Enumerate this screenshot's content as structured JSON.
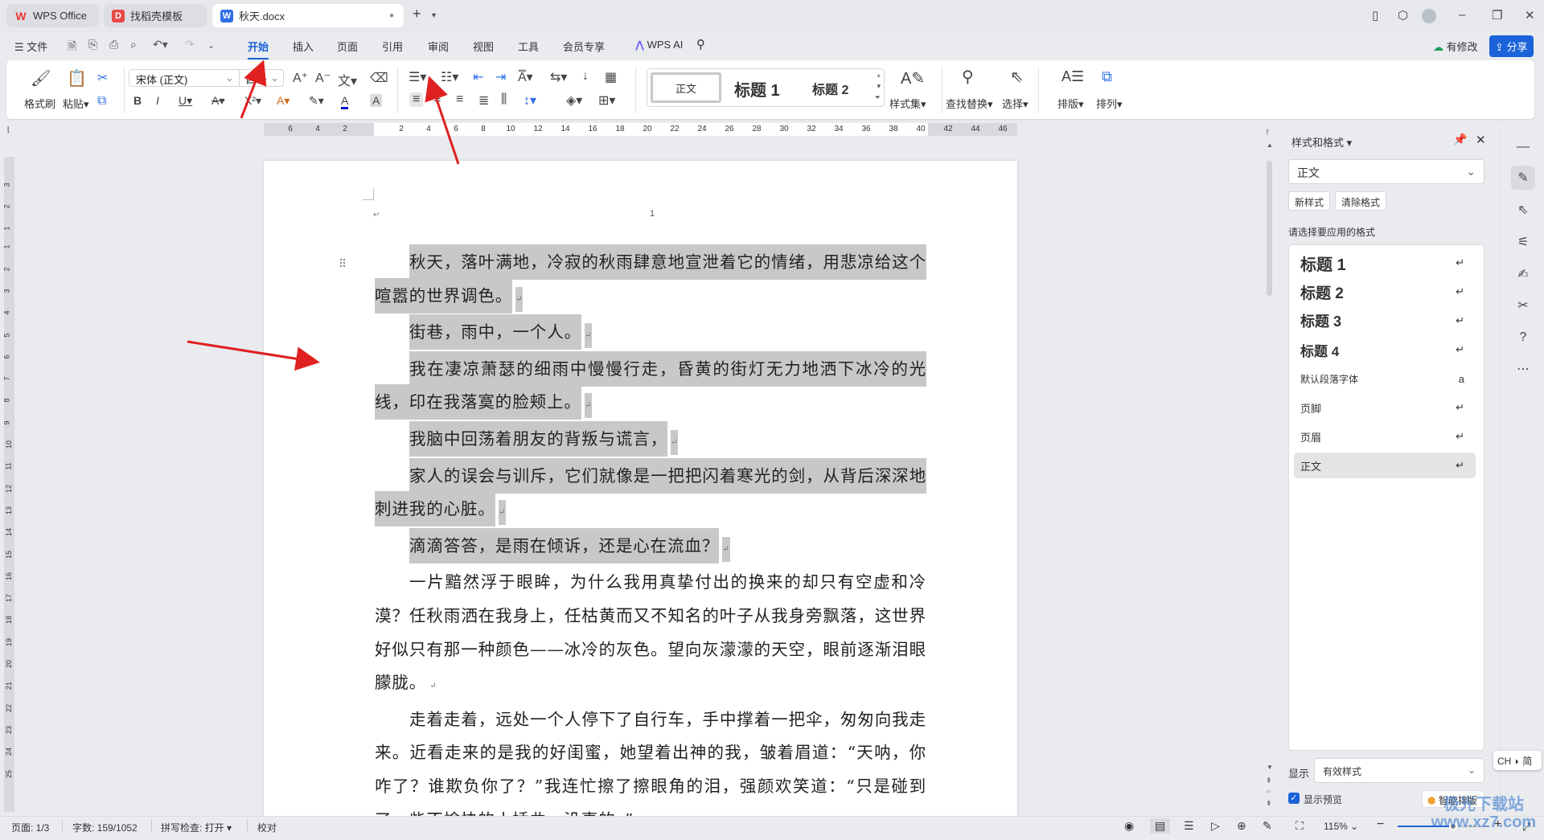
{
  "tabs": [
    {
      "label": "WPS Office",
      "icon": "W"
    },
    {
      "label": "找稻壳模板",
      "icon": "D"
    },
    {
      "label": "秋天.docx",
      "icon": "W"
    }
  ],
  "new_tab": "+",
  "menu": {
    "file": "文件",
    "tabs": [
      "开始",
      "插入",
      "页面",
      "引用",
      "审阅",
      "视图",
      "工具",
      "会员专享"
    ],
    "wps_ai": "WPS AI",
    "modified": "有修改",
    "share": "分享"
  },
  "ribbon": {
    "format_painter": "格式刷",
    "paste": "粘贴",
    "font": "宋体 (正文)",
    "size": "四号",
    "styles": [
      "正文",
      "标题 1",
      "标题 2"
    ],
    "style_set": "样式集",
    "find_replace": "查找替换",
    "select": "选择",
    "layout": "排版",
    "arrange": "排列"
  },
  "ruler": {
    "h": [
      "6",
      "4",
      "2",
      "2",
      "4",
      "6",
      "8",
      "10",
      "12",
      "14",
      "16",
      "18",
      "20",
      "22",
      "24",
      "26",
      "28",
      "30",
      "32",
      "34",
      "36",
      "38",
      "40",
      "42",
      "44",
      "46"
    ],
    "v": [
      "3",
      "2",
      "1",
      "1",
      "2",
      "3",
      "4",
      "5",
      "6",
      "7",
      "8",
      "9",
      "10",
      "11",
      "12",
      "13",
      "14",
      "15",
      "16",
      "17",
      "18",
      "19",
      "20",
      "21",
      "22",
      "23",
      "24",
      "25"
    ]
  },
  "document": {
    "page_number": "1",
    "paragraphs": [
      {
        "text": "秋天，落叶满地，冷寂的秋雨肆意地宣泄着它的情绪，用悲凉给这个喧嚣的世界调色。",
        "selected": true
      },
      {
        "text": "街巷，雨中，一个人。",
        "selected": true
      },
      {
        "text": "我在凄凉萧瑟的细雨中慢慢行走，昏黄的街灯无力地洒下冰冷的光线，印在我落寞的脸颊上。",
        "selected": true
      },
      {
        "text": "我脑中回荡着朋友的背叛与谎言，",
        "selected": true
      },
      {
        "text": "家人的误会与训斥，它们就像是一把把闪着寒光的剑，从背后深深地刺进我的心脏。",
        "selected": true
      },
      {
        "text": "滴滴答答，是雨在倾诉，还是心在流血？",
        "selected": true
      },
      {
        "text": "一片黯然浮于眼眸，为什么我用真挚付出的换来的却只有空虚和冷漠？任秋雨洒在我身上，任枯黄而又不知名的叶子从我身旁飘落，这世界好似只有那一种颜色——冰冷的灰色。望向灰濛濛的天空，眼前逐渐泪眼朦胧。",
        "selected": false
      },
      {
        "text": "走着走着，远处一个人停下了自行车，手中撑着一把伞，匆匆向我走来。近看走来的是我的好闺蜜，她望着出神的我，皱着眉道：“天呐，你咋了？谁欺负你了？”我连忙擦了擦眼角的泪，强颜欢笑道：“只是碰到了一些不愉快的小插曲，没事的。”",
        "selected": false
      }
    ],
    "paragraph_mark": "↵"
  },
  "panel": {
    "title": "样式和格式",
    "current": "正文",
    "new_style": "新样式",
    "clear_format": "清除格式",
    "prompt": "请选择要应用的格式",
    "styles": [
      {
        "label": "标题 1",
        "kind": "h1"
      },
      {
        "label": "标题 2",
        "kind": "h2"
      },
      {
        "label": "标题 3",
        "kind": "h3"
      },
      {
        "label": "标题 4",
        "kind": "h4"
      },
      {
        "label": "默认段落字体",
        "kind": "char"
      },
      {
        "label": "页脚",
        "kind": "p"
      },
      {
        "label": "页眉",
        "kind": "p"
      },
      {
        "label": "正文",
        "kind": "p",
        "selected": true
      }
    ],
    "show_label": "显示",
    "show_value": "有效样式",
    "preview_label": "显示预览",
    "preview_checked": true,
    "smart_layout": "智能排版"
  },
  "ime": "CH ◗ 简",
  "status": {
    "page": "页面: 1/3",
    "words": "字数: 159/1052",
    "spell": "拼写检查: 打开",
    "proof": "校对",
    "zoom": "115%",
    "zoom_fraction": 0.6
  },
  "watermark": "极光下载站 www.xz7.com",
  "colors": {
    "accent": "#1a63d8",
    "selection": "#c8c8c8",
    "annotation": "#e02020"
  }
}
